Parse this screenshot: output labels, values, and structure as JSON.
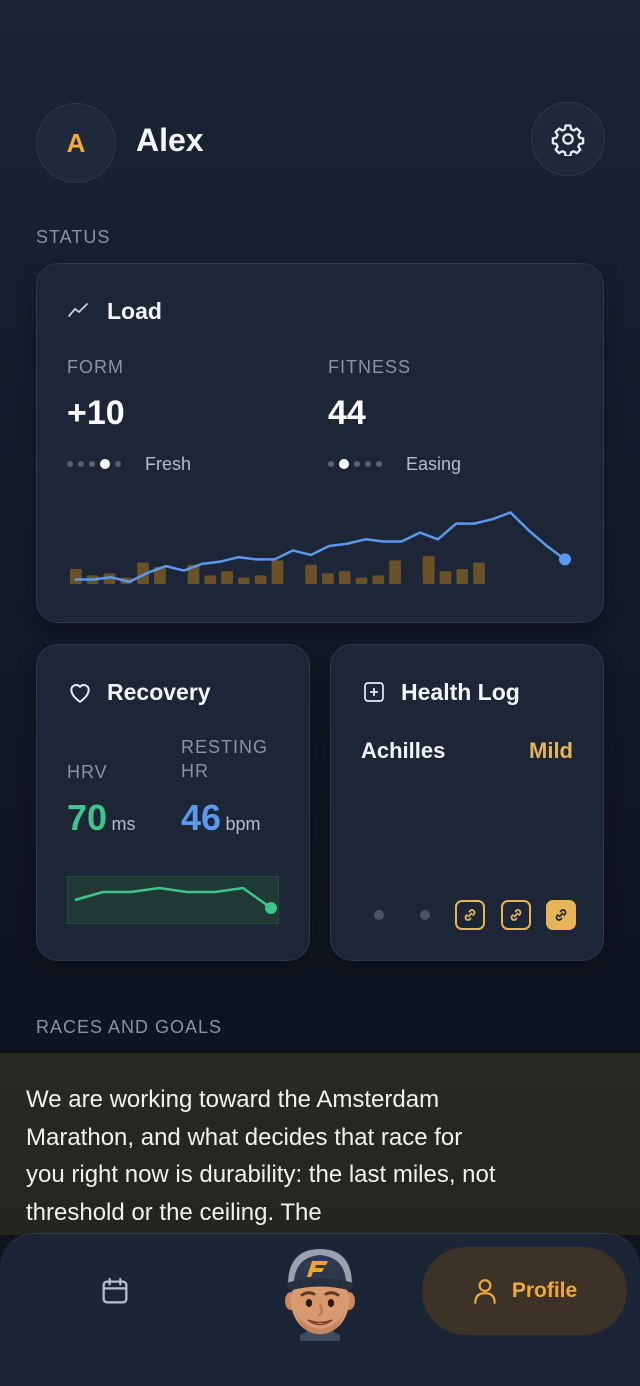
{
  "header": {
    "avatar_initial": "A",
    "user_name": "Alex",
    "settings_icon": "gear-icon"
  },
  "sections": {
    "status": "STATUS",
    "races": "RACES AND GOALS"
  },
  "load_card": {
    "title": "Load",
    "title_icon": "trend-icon",
    "form_label": "FORM",
    "form_value": "+10",
    "form_state": "Fresh",
    "form_dot_active": 3,
    "fitness_label": "FITNESS",
    "fitness_value": "44",
    "fitness_state": "Easing",
    "fitness_dot_active": 1,
    "colors": {
      "line": "#5b98ee",
      "bars": "#6a5128"
    }
  },
  "chart_data": {
    "type": "line",
    "series": [
      {
        "values": [
          2,
          2,
          3,
          1,
          5,
          8,
          6,
          9,
          10,
          12,
          11,
          11,
          15,
          13,
          17,
          18,
          20,
          19,
          19,
          23,
          20,
          27,
          27,
          29,
          32,
          24,
          17,
          11
        ]
      }
    ],
    "bars": [
      7,
      4,
      5,
      3,
      10,
      8,
      0,
      9,
      4,
      6,
      3,
      4,
      11,
      0,
      9,
      5,
      6,
      3,
      4,
      11,
      0,
      13,
      6,
      7,
      10
    ],
    "grid": false
  },
  "recovery_card": {
    "title": "Recovery",
    "title_icon": "heart-icon",
    "hrv_label": "HRV",
    "hrv_value": "70",
    "hrv_unit": "ms",
    "rhr_label_1": "RESTING",
    "rhr_label_2": "HR",
    "rhr_value": "46",
    "rhr_unit": "bpm",
    "sparkline": [
      4,
      6,
      6,
      7,
      6,
      6,
      7,
      2
    ],
    "colors": {
      "hrv": "#3ec58c",
      "rhr": "#5b98ee"
    }
  },
  "health_card": {
    "title": "Health Log",
    "title_icon": "plus-square-icon",
    "entry_name": "Achilles",
    "entry_severity": "Mild",
    "severity_color": "#e8b458"
  },
  "message": {
    "text": "We are working toward the Amsterdam Marathon, and what decides that race for you right now is durability: the last miles, not threshold or the ceiling. The"
  },
  "bottom_nav": {
    "calendar_icon": "calendar-icon",
    "coach_avatar": "coach-avatar",
    "profile_label": "Profile",
    "profile_icon": "person-icon"
  }
}
